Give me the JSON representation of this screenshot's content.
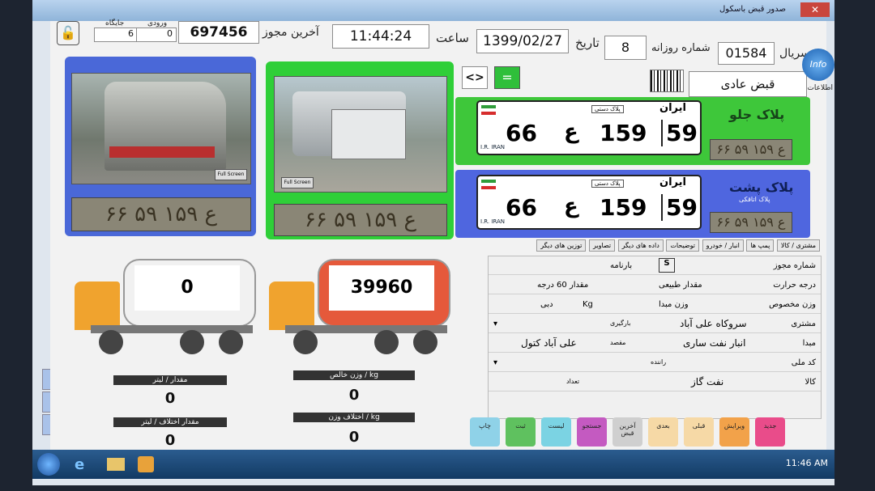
{
  "window": {
    "title": "صدور قبض باسکول"
  },
  "header": {
    "serial_label": "سریال",
    "serial_value": "01584",
    "daily_label": "شماره روزانه",
    "daily_value": "8",
    "date_label": "تاریخ",
    "date_value": "1399/02/27",
    "time_label": "ساعت",
    "time_value": "11:44:24",
    "last_permit_label": "آخرین مجوز",
    "last_permit_value": "697456",
    "entry_label": "ورودی",
    "entry_value": "0",
    "slot_label": "جایگاه",
    "slot_value": "6"
  },
  "toggle": {
    "swap": "<>",
    "equal": "="
  },
  "receipt_type": "قبض عادی",
  "front_plate": {
    "title": "پلاک جلو",
    "country": "ایران",
    "region": "59",
    "number": "159",
    "letter": "ع",
    "series": "66",
    "tag": "پلاک دستی",
    "read": "۶۶ ع ۱۵۹ ۵۹",
    "ir": "I.R. IRAN"
  },
  "rear_plate": {
    "title": "پلاک پشت",
    "sub": "پلاک اتاقکی",
    "country": "ایران",
    "region": "59",
    "number": "159",
    "letter": "ع",
    "series": "66",
    "tag": "پلاک دستی",
    "read": "۶۶ ع ۱۵۹ ۵۹",
    "ir": "I.R. IRAN"
  },
  "cameras": [
    {
      "read": "۶۶ ع ۱۵۹ ۵۹",
      "btn": "Full Screen"
    },
    {
      "read": "۶۶ ع ۱۵۹ ۵۹",
      "btn": "Full Screen"
    }
  ],
  "tanks": [
    {
      "value": "0"
    },
    {
      "value": "39960"
    }
  ],
  "stats": {
    "qty_liter": {
      "label": "مقدار / لیتر",
      "value": "0"
    },
    "net_weight": {
      "label": "وزن خالص / kg",
      "value": "0"
    },
    "qty_diff": {
      "label": "مقدار اختلاف / لیتر",
      "value": "0"
    },
    "weight_diff": {
      "label": "اختلاف وزن / kg",
      "value": "0"
    }
  },
  "tabs": [
    "مشتری / کالا",
    "پمپ ها",
    "انبار / خودرو",
    "توضیحات",
    "داده های دیگر",
    "تصاویر",
    "توزین های دیگر"
  ],
  "form": {
    "permit_label": "شماره مجوز",
    "bill_label": "بارنامه",
    "bill_code": "S",
    "temp_label": "درجه حرارت",
    "temp_value": "مقدار 60 درجه",
    "natural_label": "مقدار طبیعی",
    "density_label": "وزن مخصوص",
    "origin_weight_label": "وزن مبدا",
    "unit_kg": "Kg",
    "unit_dbl": "دبی",
    "customer_label": "مشتری",
    "customer_value": "سروکاه علی آباد",
    "loader_label": "بارگیری",
    "origin_label": "مبدا",
    "origin_value": "انبار نفت ساری",
    "dest_label": "مقصد",
    "dest_value": "علی آباد کتول",
    "code_label": "کد ملی",
    "vehicle_label": "راننده",
    "goods_label": "کالا",
    "goods_value": "نفت گاز",
    "count_label": "تعداد"
  },
  "buttons": [
    {
      "label": "جدید",
      "color": "#e94c8a"
    },
    {
      "label": "ویرایش",
      "color": "#f2a24a"
    },
    {
      "label": "قبلی",
      "color": "#f6d9a6"
    },
    {
      "label": "بعدی",
      "color": "#f6d9a6"
    },
    {
      "label": "آخرین قبض",
      "color": "#cfcfcf"
    },
    {
      "label": "جستجو",
      "color": "#c45ac1"
    },
    {
      "label": "لیست",
      "color": "#7bd3e3"
    },
    {
      "label": "ثبت",
      "color": "#5fc15f"
    },
    {
      "label": "چاپ",
      "color": "#8fd2e8"
    }
  ],
  "desktop": {
    "info": "Info",
    "info_label": "اطلاعات"
  },
  "taskbar": {
    "clock": "11:46 AM"
  }
}
